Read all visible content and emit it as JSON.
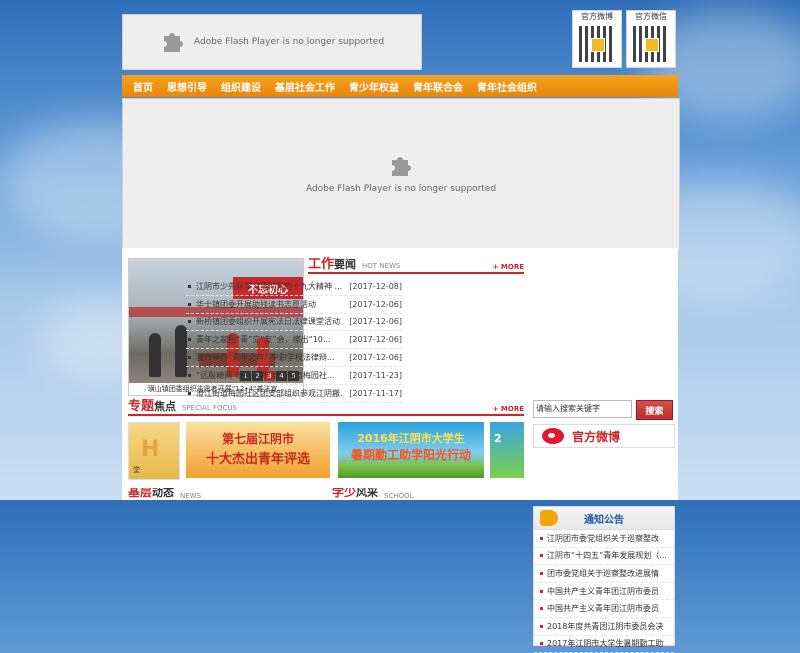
{
  "flash": {
    "header_message": "Adobe Flash Player is no longer supported",
    "banner_message": "Adobe Flash Player is no longer supported"
  },
  "qr": [
    {
      "label": "官方微博"
    },
    {
      "label": "官方微信"
    }
  ],
  "nav": {
    "items": [
      "首页",
      "思想引导",
      "组织建设",
      "基层社会工作",
      "青少年权益",
      "青年联合会",
      "青年社会组织"
    ]
  },
  "slider": {
    "banner_text": "不忘初心",
    "pages": [
      "1",
      "2",
      "3",
      "4",
      "5"
    ],
    "active_page": "3",
    "caption": "璜山镇团委组织志愿者开展“12•4”普法宣..."
  },
  "work_news": {
    "title_red": "工作",
    "title_black": "要闻",
    "title_en": "HOT NEWS",
    "more": "+ MORE",
    "items": [
      {
        "title": "江阴市少先队学习贯彻党的十九大精神 ...",
        "date": "[2017-12-08]"
      },
      {
        "title": "华士镇团委开展助残读书志愿活动",
        "date": "[2017-12-06]"
      },
      {
        "title": "新桥镇团委组织开展宪法日法律课堂活动",
        "date": "[2017-12-06]"
      },
      {
        "title": "青年之家相“青”交“友”会，擦出“10...",
        "date": "[2017-12-06]"
      },
      {
        "title": "我市举办“青年之声” 中职学校法律辩...",
        "date": "[2017-12-06]"
      },
      {
        "title": "“远殷糖网 守护光明”澄江街道梅园社...",
        "date": "[2017-11-23]"
      },
      {
        "title": "澄江街道梅园社区团支部组织参观江阴搬...",
        "date": "[2017-11-17]"
      }
    ]
  },
  "notice": {
    "title": "通知公告",
    "items": [
      "江阴团市委党组织关于巡察整改",
      "江阴市“十四五”青年发展规划（...",
      "团市委党组关于巡察整改进展情",
      "中国共产主义青年团江阴市委员",
      "中国共产主义青年团江阴市委员",
      "2018年度共青团江阴市委员会决",
      "2017年江阴市大学生暑期勤工助"
    ]
  },
  "search": {
    "placeholder": "请输入搜索关键字",
    "button": "搜索"
  },
  "weibo": {
    "label": "官方微博"
  },
  "focus": {
    "title_red": "专题",
    "title_black": "焦点",
    "title_en": "SPECIAL FOCUS",
    "more": "+ MORE",
    "cards": [
      {
        "line1": "H",
        "line2": "堂"
      },
      {
        "line1": "第七届江阴市",
        "line2": "十大杰出青年评选"
      },
      {
        "line1": "2016年江阴市大学生",
        "line2": "暑期勤工助学阳光行动"
      },
      {
        "line1": "2"
      }
    ]
  },
  "bottom": {
    "left_red": "基层",
    "left_black": "动态",
    "left_en": "NEWS",
    "right_red": "学少",
    "right_black": "风采",
    "right_en": "SCHOOL"
  }
}
